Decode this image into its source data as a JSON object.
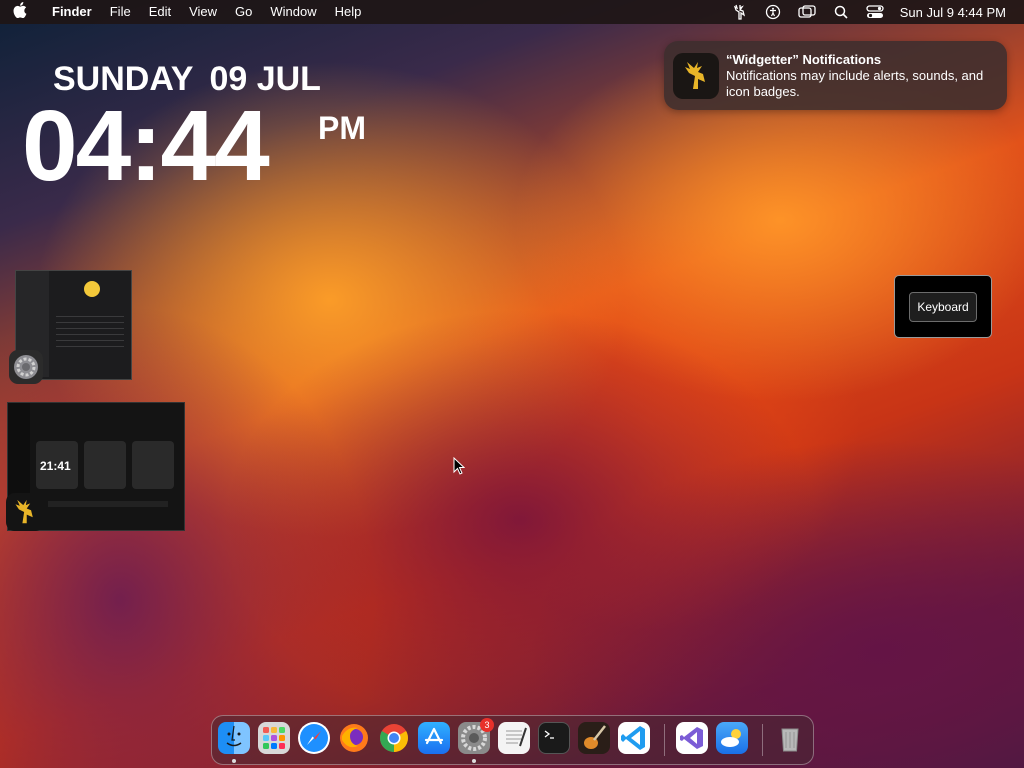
{
  "menubar": {
    "app_name": "Finder",
    "items": [
      "File",
      "Edit",
      "View",
      "Go",
      "Window",
      "Help"
    ],
    "status_icons": [
      "widgetter-icon",
      "accessibility-icon",
      "screen-mirroring-icon",
      "search-icon",
      "control-center-icon"
    ],
    "clock": "Sun Jul 9  4:44 PM"
  },
  "widget_clock": {
    "day": "SUNDAY",
    "date": "09 JUL",
    "time": "04:44",
    "ampm": "PM"
  },
  "notification": {
    "title": "“Widgetter” Notifications",
    "body": "Notifications may include alerts, sounds, and icon badges."
  },
  "keyboard_popup": {
    "label": "Keyboard"
  },
  "thumbnail_widgetter": {
    "time": "21:41"
  },
  "dock": {
    "apps": [
      {
        "name": "Finder",
        "color": "#2d8cf0",
        "running": true
      },
      {
        "name": "Launchpad",
        "color": "#c8c8c8",
        "running": false
      },
      {
        "name": "Safari",
        "color": "#2a8ce6",
        "running": false
      },
      {
        "name": "Firefox",
        "color": "#ff7a1a",
        "running": false
      },
      {
        "name": "Chrome",
        "color": "#eaeaea",
        "running": false
      },
      {
        "name": "App Store",
        "color": "#1e8ef0",
        "running": false
      },
      {
        "name": "System Settings",
        "color": "#8a8a8a",
        "running": true,
        "badge": "3"
      },
      {
        "name": "TextEdit",
        "color": "#f2f2f2",
        "running": false
      },
      {
        "name": "Terminal",
        "color": "#1a1a1a",
        "running": false
      },
      {
        "name": "GarageBand",
        "color": "#3a2a20",
        "running": false
      },
      {
        "name": "Visual Studio Code",
        "color": "#ffffff",
        "running": false
      },
      {
        "name": "Visual Studio",
        "color": "#ffffff",
        "running": false
      },
      {
        "name": "Weather",
        "color": "#3aa0f0",
        "running": false
      },
      {
        "name": "Trash",
        "color": "#9a9a9a",
        "running": false
      }
    ]
  }
}
